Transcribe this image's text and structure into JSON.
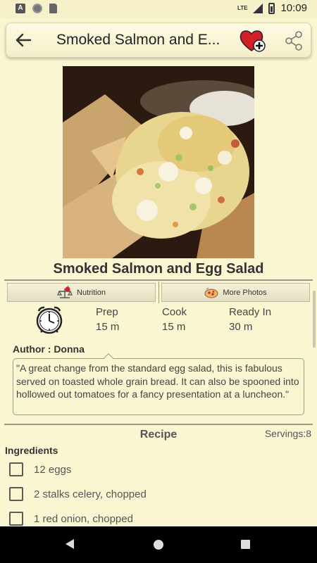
{
  "status_bar": {
    "time": "10:09",
    "network": "LTE"
  },
  "toolbar": {
    "title": "Smoked Salmon and E..."
  },
  "recipe": {
    "title": "Smoked Salmon and Egg Salad",
    "tabs": {
      "nutrition": "Nutrition",
      "photos": "More Photos"
    },
    "times": {
      "prep_label": "Prep",
      "prep_value": "15 m",
      "cook_label": "Cook",
      "cook_value": "15 m",
      "ready_label": "Ready In",
      "ready_value": "30 m"
    },
    "author": "Author : Donna",
    "description": "\"A great change from the standard egg salad, this is fabulous served on toasted whole grain bread. It can also be spooned into hollowed out tomatoes for a fancy presentation at a luncheon.\"",
    "section_title": "Recipe",
    "servings": "Servings:8",
    "ingredients_title": "Ingredients",
    "ingredients": [
      "12 eggs",
      "2 stalks celery, chopped",
      "1 red onion, chopped"
    ]
  },
  "colors": {
    "background": "#fbf6d2",
    "accent_red": "#d21f2a"
  },
  "icons": {
    "toolbar": [
      "back-arrow-icon",
      "favorite-add-icon",
      "share-icon"
    ],
    "tabs": [
      "nutrition-scale-icon",
      "photos-pizza-icon"
    ],
    "time": "alarm-clock-icon",
    "nav": [
      "nav-back-icon",
      "nav-home-icon",
      "nav-recents-icon"
    ]
  }
}
